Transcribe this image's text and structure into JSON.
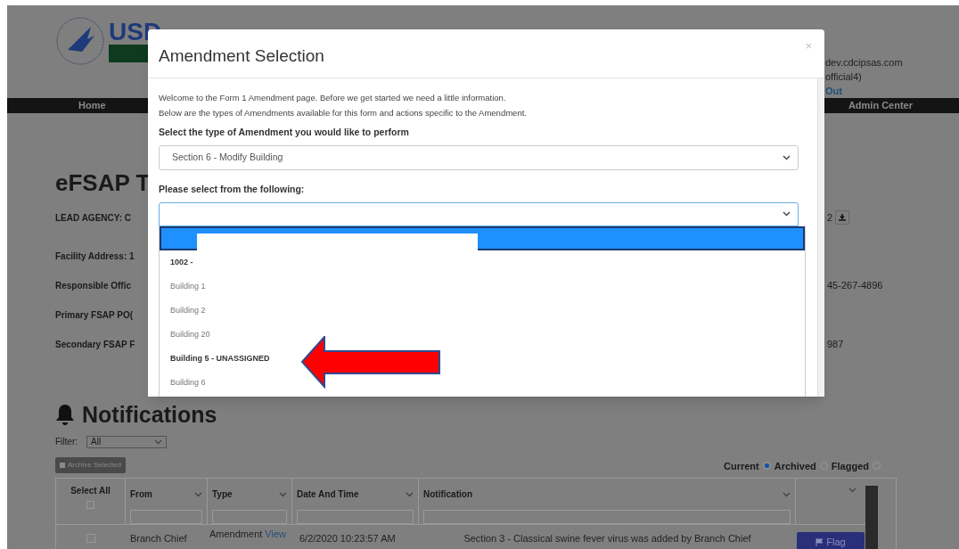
{
  "header": {
    "logo_text": "USD",
    "user_lines": [
      "dev.cdcipsas.com",
      "official4)"
    ],
    "sign_out": "Out"
  },
  "nav": {
    "items": [
      "Home",
      "Admin Center"
    ]
  },
  "page": {
    "title": "eFSAP T",
    "fields": [
      {
        "label": "LEAD AGENCY: C",
        "value": "2",
        "download": true
      },
      {
        "label": "Facility Address: 1"
      },
      {
        "label": "Responsible Offic",
        "value": "45-267-4896"
      },
      {
        "label": "Primary FSAP PO("
      },
      {
        "label": "Secondary FSAP F",
        "value": "987"
      }
    ]
  },
  "notifications": {
    "title": "Notifications",
    "filter_label": "Filter:",
    "filter_value": "All",
    "archive_button": "Archive Selected",
    "views": [
      {
        "label": "Current",
        "selected": true
      },
      {
        "label": "Archived",
        "selected": false
      },
      {
        "label": "Flagged",
        "selected": false
      }
    ],
    "table": {
      "select_all": "Select All",
      "select_all_checked": false,
      "columns": [
        "From",
        "Type",
        "Date And Time",
        "Notification"
      ],
      "rows": [
        {
          "checked": false,
          "from": "Branch Chief",
          "type": "Amendment",
          "type_link": "View",
          "date": "6/2/2020 10:23:57 AM",
          "notification": "Section 3 - Classical swine fever virus was added by Branch Chief",
          "action": "Flag"
        }
      ]
    }
  },
  "modal": {
    "title": "Amendment Selection",
    "close": "×",
    "intro": [
      "Welcome to the Form 1 Amendment page. Before we get started we need a little information.",
      "Below are the types of Amendments available for this form and actions specific to the Amendment."
    ],
    "type_label": "Select the type of Amendment you would like to perform",
    "type_value": "Section 6 - Modify Building",
    "item_label": "Please select from the following:",
    "options": [
      {
        "kind": "redacted",
        "selected": true
      },
      {
        "kind": "option",
        "label": "1002 -",
        "emphasized": true,
        "selected": false
      },
      {
        "kind": "option",
        "label": "Building 1",
        "emphasized": false,
        "selected": false
      },
      {
        "kind": "option",
        "label": "Building 2",
        "emphasized": false,
        "selected": false
      },
      {
        "kind": "option",
        "label": "Building 20",
        "emphasized": false,
        "selected": false
      },
      {
        "kind": "option",
        "label": "Building 5 - UNASSIGNED",
        "emphasized": true,
        "selected": false
      },
      {
        "kind": "option",
        "label": "Building 6",
        "emphasized": false,
        "selected": false
      }
    ]
  }
}
